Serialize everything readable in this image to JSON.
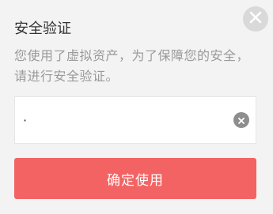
{
  "dialog": {
    "title": "安全验证",
    "description": "您使用了虚拟资产，为了保障您的安全，请进行安全验证。",
    "input": {
      "value": "·",
      "placeholder": ""
    },
    "confirm_label": "确定使用",
    "close_icon": "close-icon",
    "clear_icon": "clear-icon"
  },
  "colors": {
    "background": "#f3f3f3",
    "title_text": "#333333",
    "description_text": "#9a9a9a",
    "button_bg": "#f36363",
    "button_text": "#ffffff",
    "icon_circle": "#d9d9d9",
    "clear_circle": "#8e8e8e"
  }
}
